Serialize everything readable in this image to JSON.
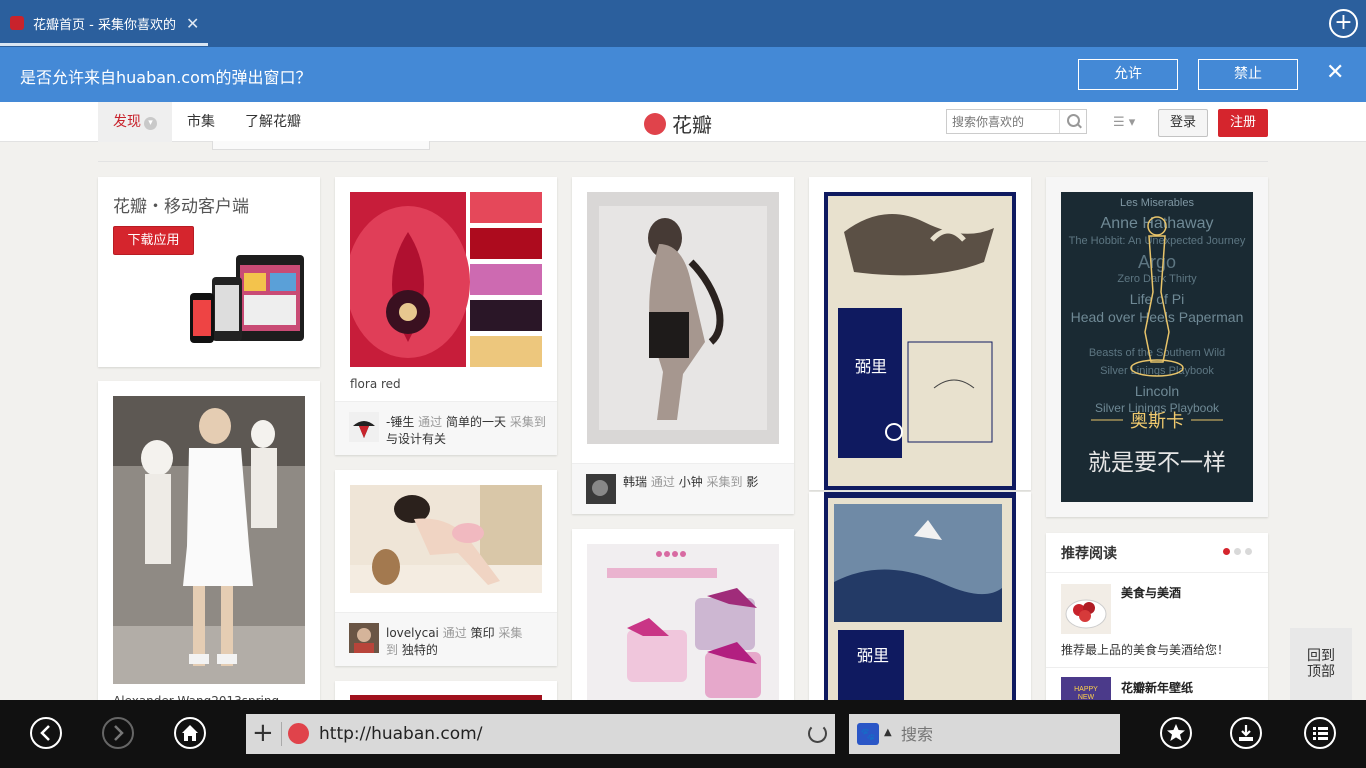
{
  "browser": {
    "tab_title": "花瓣首页 - 采集你喜欢的",
    "url": "http://huaban.com/",
    "search_placeholder": "搜索",
    "engine_glyph": "🐾"
  },
  "popup": {
    "message": "是否允许来自huaban.com的弹出窗口？",
    "allow": "允许",
    "block": "禁止"
  },
  "site": {
    "nav": [
      "发现",
      "市集",
      "了解花瓣"
    ],
    "logo": "花瓣",
    "search_placeholder": "搜索你喜欢的",
    "login": "登录",
    "register": "注册"
  },
  "app_card": {
    "title": "花瓣・移动客户端",
    "download": "下载应用"
  },
  "cards": [
    {
      "caption": "flora red",
      "user": "-锤生",
      "via": "通过",
      "source": "简单的一天",
      "collected": "采集到",
      "board": "与设计有关"
    },
    {
      "user": "韩瑞",
      "via": "通过",
      "source": "小钟",
      "collected": "采集到",
      "board": "影"
    },
    {
      "user": "lovelycai",
      "via": "通过",
      "source": "策印",
      "collected": "采集",
      "collected2": "到",
      "board": "独特的"
    }
  ],
  "fashion_caption": "Alexander Wang2013spring",
  "oscar": {
    "title_cn": "奥斯卡",
    "tagline": "就是要不一样"
  },
  "recommended": {
    "header": "推荐阅读",
    "items": [
      {
        "title": "美食与美酒",
        "desc": "推荐最上品的美食与美酒给您！"
      },
      {
        "title": "花瓣新年壁纸"
      }
    ]
  },
  "back_to_top": [
    "回到",
    "顶部"
  ],
  "colors": {
    "brand_red": "#d5252d",
    "tabbar": "#2b5f9d",
    "popup": "#4489d6"
  },
  "icons": {
    "back": "chevron-left-icon",
    "forward": "chevron-right-icon",
    "home": "home-icon",
    "favorite": "star-icon",
    "download": "download-icon",
    "menu": "menu-list-icon"
  }
}
